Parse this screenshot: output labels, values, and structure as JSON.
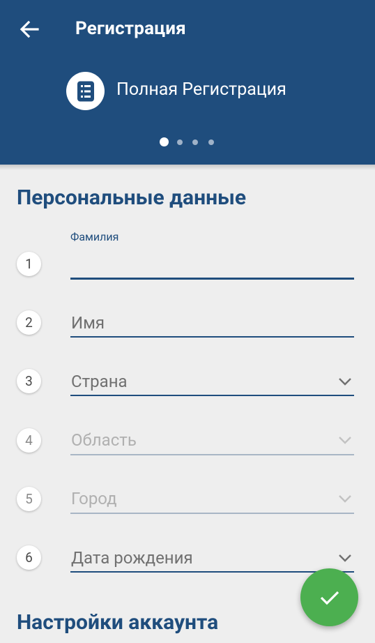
{
  "appbar": {
    "title": "Регистрация",
    "registration_type": "Полная Регистрация",
    "pager": {
      "count": 4,
      "active_index": 0
    }
  },
  "colors": {
    "primary": "#1f4d7d",
    "fab": "#4caf50",
    "background": "#eeeeee"
  },
  "sections": {
    "personal": "Персональные данные",
    "account": "Настройки аккаунта"
  },
  "fields": [
    {
      "number": "1",
      "label": "Фамилия",
      "value": "",
      "placeholder": "",
      "dropdown": false,
      "enabled": true
    },
    {
      "number": "2",
      "label": "",
      "value": "",
      "placeholder": "Имя",
      "dropdown": false,
      "enabled": true
    },
    {
      "number": "3",
      "label": "",
      "value": "",
      "placeholder": "Страна",
      "dropdown": true,
      "enabled": true
    },
    {
      "number": "4",
      "label": "",
      "value": "",
      "placeholder": "Область",
      "dropdown": true,
      "enabled": false
    },
    {
      "number": "5",
      "label": "",
      "value": "",
      "placeholder": "Город",
      "dropdown": true,
      "enabled": false
    },
    {
      "number": "6",
      "label": "",
      "value": "",
      "placeholder": "Дата рождения",
      "dropdown": true,
      "enabled": true
    }
  ],
  "icons": {
    "back": "arrow-left-icon",
    "registration": "list-document-icon",
    "dropdown": "chevron-down-icon",
    "fab": "checkmark-icon"
  }
}
